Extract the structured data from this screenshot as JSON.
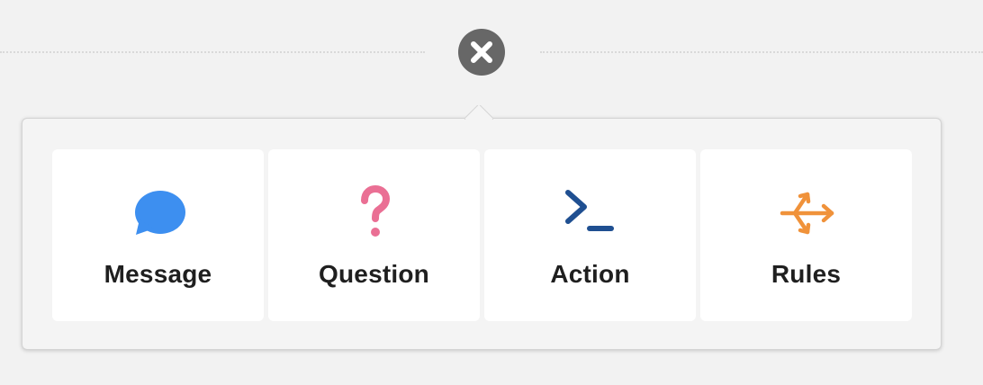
{
  "close": {
    "icon": "close-icon"
  },
  "menu": {
    "items": [
      {
        "label": "Message",
        "icon": "chat-bubble-icon",
        "color": "#3d8ff0"
      },
      {
        "label": "Question",
        "icon": "question-mark-icon",
        "color": "#ea6f94"
      },
      {
        "label": "Action",
        "icon": "terminal-prompt-icon",
        "color": "#1f4f91"
      },
      {
        "label": "Rules",
        "icon": "branch-arrows-icon",
        "color": "#f0923a"
      }
    ]
  }
}
